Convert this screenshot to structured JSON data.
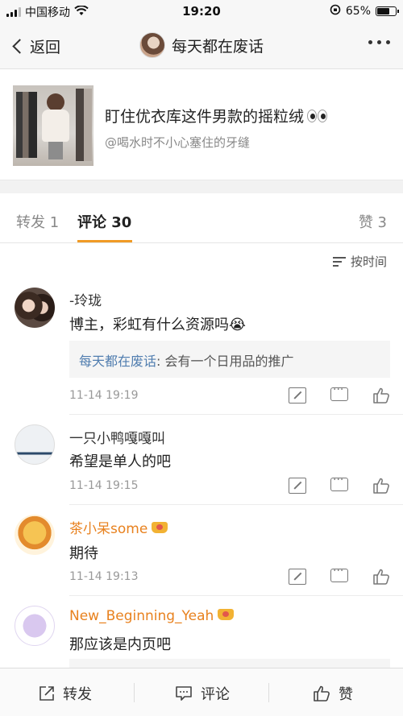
{
  "status_bar": {
    "carrier": "中国移动",
    "time": "19:20",
    "battery": "65%"
  },
  "nav": {
    "back_label": "返回",
    "title": "每天都在废话"
  },
  "post": {
    "title": "盯住优衣库这件男款的摇粒绒",
    "author": "@喝水时不小心塞住的牙缝"
  },
  "tabs": {
    "repost": "转发 1",
    "comment": "评论 30",
    "like": "赞 3"
  },
  "sort_label": "按时间",
  "comments": [
    {
      "name": "-玲珑",
      "text": "博主，彩虹有什么资源吗😭",
      "reply_who": "每天都在废话",
      "reply_text": ": 会有一个日用品的推广",
      "time": "11-14 19:19"
    },
    {
      "name": "一只小鸭嘎嘎叫",
      "text": "希望是单人的吧",
      "time": "11-14 19:15"
    },
    {
      "name": "茶小呆some",
      "text": "期待",
      "time": "11-14 19:13"
    },
    {
      "name": "New_Beginning_Yeah",
      "text": "那应该是内页吧"
    }
  ],
  "bottom": {
    "repost": "转发",
    "comment": "评论",
    "like": "赞"
  },
  "colors": {
    "accent": "#f09b26",
    "vip_name": "#e8811e",
    "link": "#507daf"
  }
}
